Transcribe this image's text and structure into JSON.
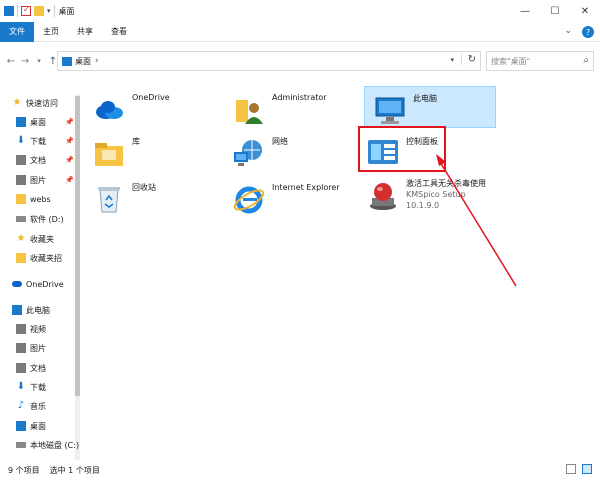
{
  "window": {
    "title": "桌面"
  },
  "ribbon": {
    "tabs": [
      "文件",
      "主页",
      "共享",
      "查看"
    ]
  },
  "address": {
    "path": "桌面",
    "search_placeholder": "搜索\"桌面\""
  },
  "sidebar": {
    "items": [
      {
        "label": "快速访问",
        "icon": "star-icon",
        "pinned": false
      },
      {
        "label": "桌面",
        "icon": "desktop-icon",
        "pinned": true
      },
      {
        "label": "下载",
        "icon": "download-icon",
        "pinned": true
      },
      {
        "label": "文档",
        "icon": "document-icon",
        "pinned": true
      },
      {
        "label": "图片",
        "icon": "picture-icon",
        "pinned": true
      },
      {
        "label": "webs",
        "icon": "folder-icon",
        "pinned": false
      },
      {
        "label": "软件 (D:)",
        "icon": "drive-icon",
        "pinned": false
      },
      {
        "label": "收藏夹",
        "icon": "star-icon",
        "pinned": false
      },
      {
        "label": "收藏夹招",
        "icon": "folder-icon",
        "pinned": false
      },
      {
        "label": "OneDrive",
        "icon": "cloud-icon",
        "pinned": false
      },
      {
        "label": "此电脑",
        "icon": "computer-icon",
        "pinned": false
      },
      {
        "label": "视频",
        "icon": "video-icon",
        "pinned": false
      },
      {
        "label": "图片",
        "icon": "picture-icon",
        "pinned": false
      },
      {
        "label": "文档",
        "icon": "document-icon",
        "pinned": false
      },
      {
        "label": "下载",
        "icon": "download-icon",
        "pinned": false
      },
      {
        "label": "音乐",
        "icon": "music-icon",
        "pinned": false
      },
      {
        "label": "桌面",
        "icon": "desktop-icon",
        "pinned": false
      },
      {
        "label": "本地磁盘 (C:)",
        "icon": "drive-icon",
        "pinned": false
      }
    ]
  },
  "items": [
    {
      "label": "OneDrive",
      "icon": "onedrive-icon"
    },
    {
      "label": "Administrator",
      "icon": "user-folder-icon"
    },
    {
      "label": "此电脑",
      "icon": "computer-icon",
      "selected": true
    },
    {
      "label": "库",
      "icon": "library-icon"
    },
    {
      "label": "网络",
      "icon": "network-icon"
    },
    {
      "label": "控制面板",
      "icon": "control-panel-icon",
      "highlighted": true
    },
    {
      "label": "回收站",
      "icon": "recycle-bin-icon"
    },
    {
      "label": "Internet Explorer",
      "icon": "ie-icon"
    },
    {
      "label": "激活工具无关杀毒使用",
      "sub1": "KMSpico Setup",
      "sub2": "10.1.9.0",
      "icon": "kmspico-icon"
    }
  ],
  "status": {
    "count": "9 个项目",
    "selected": "选中 1 个项目"
  },
  "colors": {
    "accent": "#1979ca",
    "highlight": "#e0141b",
    "selection": "#cce8ff"
  }
}
